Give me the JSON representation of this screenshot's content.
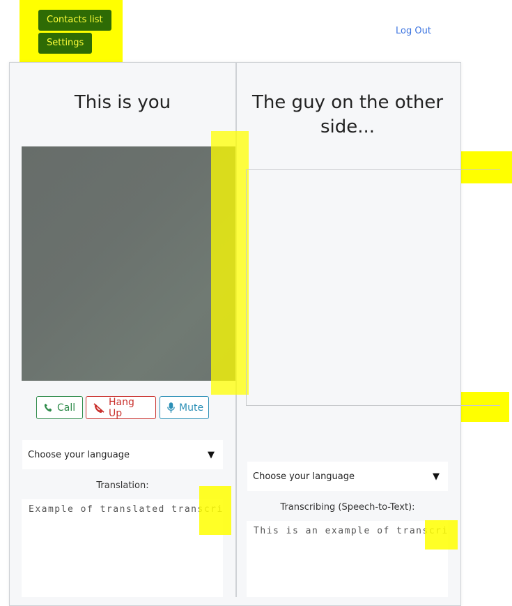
{
  "nav": {
    "contacts_label": "Contacts list",
    "settings_label": "Settings",
    "logout_label": "Log Out"
  },
  "local": {
    "heading": "This is you",
    "call_label": "Call",
    "hangup_label": "Hang Up",
    "mute_label": "Mute",
    "language_select": "Choose your language",
    "translation_label": "Translation:",
    "translation_text": "Example of translated transcript"
  },
  "remote": {
    "heading": "The guy on the other side...",
    "language_select": "Choose your language",
    "transcribing_label": "Transcribing (Speech-to-Text):",
    "transcript_text": "This is an example of transcribing"
  },
  "colors": {
    "highlight": "#ffff00",
    "nav_button_bg": "#2e6b05",
    "nav_button_text": "#ffff3a",
    "link": "#3c74e0",
    "call": "#2e8b4a",
    "hangup": "#c9302c",
    "mute": "#2b8fb6"
  }
}
